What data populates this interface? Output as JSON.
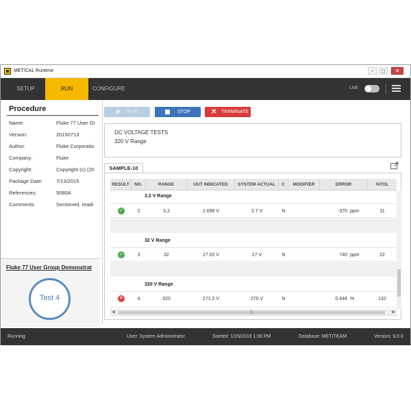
{
  "window": {
    "title": "MET/CAL Runtime",
    "minimize": "−",
    "maximize": "◻",
    "close": "✕"
  },
  "nav": {
    "tabs": [
      {
        "label": "SETUP"
      },
      {
        "label": "RUN"
      },
      {
        "label": "CONFIGURE"
      }
    ],
    "active_tab": "RUN",
    "live_label": "LIVE",
    "live_on": false
  },
  "procedure": {
    "title": "Procedure",
    "fields": [
      {
        "key": "Name:",
        "value": "Fluke 77 User Gr"
      },
      {
        "key": "Version:",
        "value": "20150713"
      },
      {
        "key": "Author:",
        "value": "Fluke Corporatio"
      },
      {
        "key": "Company:",
        "value": "Fluke"
      },
      {
        "key": "Copyright:",
        "value": "Copyright (c) (20"
      },
      {
        "key": "Package Date:",
        "value": "7/13/2015"
      },
      {
        "key": "References:",
        "value": "5080A"
      },
      {
        "key": "Comments:",
        "value": "Sectioned, readi"
      }
    ],
    "scroll_thumb": "|||"
  },
  "test_group": {
    "title": "Fluke 77 User Group Demonstrat",
    "current_test": "Test 4"
  },
  "actions": {
    "run": "RUN",
    "stop": "STOP",
    "terminate": "TERMINATE"
  },
  "description": {
    "line1": "DC VOLTAGE TESTS",
    "line2": "320 V Range"
  },
  "sample_tab": "SAMPLE-10",
  "grid": {
    "columns": [
      "RESULT",
      "NO.",
      "RANGE",
      "UUT INDICATED",
      "SYSTEM ACTUAL",
      "C",
      "MODIFIER",
      "ERROR",
      "%TOL"
    ],
    "groups": [
      {
        "title": "3.2 V Range",
        "row": {
          "result": "pass",
          "result_glyph": "✓",
          "no": "2",
          "range": "3.2",
          "uut": "2.699 V",
          "actual": "2.7 V",
          "c": "N",
          "modifier": "",
          "error": "-370",
          "error_unit": "ppm",
          "tol": "11"
        }
      },
      {
        "title": "32 V Range",
        "row": {
          "result": "pass",
          "result_glyph": "✓",
          "no": "3",
          "range": "32",
          "uut": "27.02 V",
          "actual": "27 V",
          "c": "N",
          "modifier": "",
          "error": "740",
          "error_unit": "ppm",
          "tol": "22"
        }
      },
      {
        "title": "320 V Range",
        "row": {
          "result": "fail",
          "result_glyph": "✕",
          "no": "4",
          "range": "320",
          "uut": "271.2 V",
          "actual": "270 V",
          "c": "N",
          "modifier": "",
          "error": "0.444",
          "error_unit": "%",
          "tol": "132"
        }
      }
    ],
    "scroll_thumb": "|||"
  },
  "status": {
    "state": "Running",
    "user": "User: System Administrator",
    "started": "Started: 1/26/2016 1:06 PM",
    "database": "Database: MET/TEAM",
    "version": "Version: 9.0.0"
  },
  "colors": {
    "accent": "#f7b800",
    "nav_bg": "#333333",
    "stop": "#3c73b9",
    "terminate": "#d93a3a",
    "pass": "#4aab4a",
    "fail": "#d94040",
    "test_circle": "#5a8ac0"
  }
}
